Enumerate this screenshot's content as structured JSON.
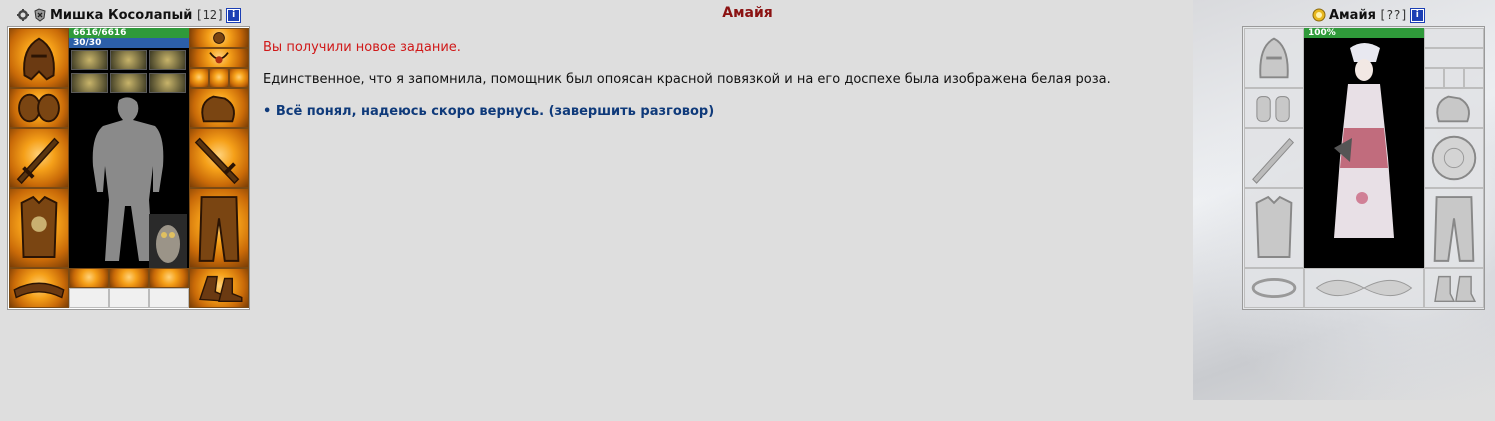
{
  "player": {
    "name": "Мишка Косолапый",
    "level": "[12]",
    "info_badge": "i",
    "hp": "6616/6616",
    "mana": "30/30",
    "icons": [
      "clan-icon",
      "alignment-icon"
    ]
  },
  "npc": {
    "title": "Амайя",
    "name": "Амайя",
    "level": "[??]",
    "info_badge": "i",
    "hp_percent": "100%"
  },
  "dialog": {
    "quest_message": "Вы получили новое задание.",
    "text": "Единственное, что я запомнила, помощник был опоясан красной повязкой и на его доспехе была изображена белая роза.",
    "answer_bullet": "•",
    "answer": "Всё понял, надеюсь скоро вернусь. (завершить разговор)"
  },
  "colors": {
    "background": "#dedede",
    "title": "#8b1212",
    "quest_message": "#d01818",
    "answer": "#0f3a7a",
    "hp_bar": "#2f9a3a",
    "mana_bar": "#2c5fa8"
  }
}
